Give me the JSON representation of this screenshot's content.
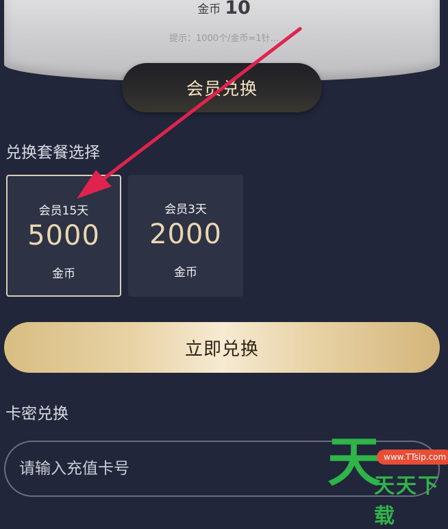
{
  "header": {
    "coin_label": "金币",
    "coin_value": "10",
    "hint": "提示：1000个/金币=1针..."
  },
  "vip_exchange_button": "会员兑换",
  "package_section": {
    "title": "兑换套餐选择",
    "packages": [
      {
        "name": "会员15天",
        "price": "5000",
        "unit": "金币",
        "selected": true
      },
      {
        "name": "会员3天",
        "price": "2000",
        "unit": "金币",
        "selected": false
      }
    ]
  },
  "redeem_button": "立即兑换",
  "card_section": {
    "title": "卡密兑换",
    "input_placeholder": "请输入充值卡号",
    "input_value": ""
  },
  "annotation": {
    "arrow_color": "#e0234e"
  },
  "watermark": {
    "big_char": "天",
    "url_text": "www.TTsip.com",
    "text": "天天下载",
    "green": "#2fb44a",
    "red": "#e84d35"
  }
}
